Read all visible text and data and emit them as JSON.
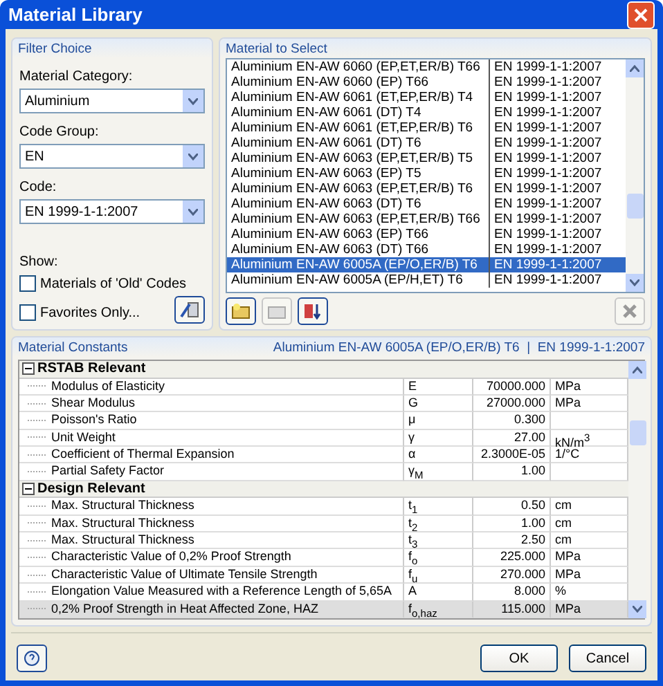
{
  "window": {
    "title": "Material Library"
  },
  "filter": {
    "title": "Filter Choice",
    "fields": [
      {
        "label": "Material Category:",
        "value": "Aluminium"
      },
      {
        "label": "Code Group:",
        "value": "EN"
      },
      {
        "label": "Code:",
        "value": "EN 1999-1-1:2007"
      }
    ],
    "show_label": "Show:",
    "checkboxes": [
      {
        "label": "Materials of 'Old' Codes",
        "checked": false
      },
      {
        "label": "Favorites Only...",
        "checked": false
      }
    ]
  },
  "materials": {
    "title": "Material to Select",
    "rows": [
      {
        "name": "Aluminium EN-AW 6060 (EP,ET,ER/B) T66",
        "code": "EN 1999-1-1:2007",
        "selected": false
      },
      {
        "name": "Aluminium EN-AW 6060 (EP) T66",
        "code": "EN 1999-1-1:2007",
        "selected": false
      },
      {
        "name": "Aluminium EN-AW 6061 (ET,EP,ER/B) T4",
        "code": "EN 1999-1-1:2007",
        "selected": false
      },
      {
        "name": "Aluminium EN-AW 6061 (DT) T4",
        "code": "EN 1999-1-1:2007",
        "selected": false
      },
      {
        "name": "Aluminium EN-AW 6061 (ET,EP,ER/B) T6",
        "code": "EN 1999-1-1:2007",
        "selected": false
      },
      {
        "name": "Aluminium EN-AW 6061 (DT) T6",
        "code": "EN 1999-1-1:2007",
        "selected": false
      },
      {
        "name": "Aluminium EN-AW 6063 (EP,ET,ER/B) T5",
        "code": "EN 1999-1-1:2007",
        "selected": false
      },
      {
        "name": "Aluminium EN-AW 6063 (EP) T5",
        "code": "EN 1999-1-1:2007",
        "selected": false
      },
      {
        "name": "Aluminium EN-AW 6063 (EP,ET,ER/B) T6",
        "code": "EN 1999-1-1:2007",
        "selected": false
      },
      {
        "name": "Aluminium EN-AW 6063 (DT) T6",
        "code": "EN 1999-1-1:2007",
        "selected": false
      },
      {
        "name": "Aluminium EN-AW 6063 (EP,ET,ER/B) T66",
        "code": "EN 1999-1-1:2007",
        "selected": false
      },
      {
        "name": "Aluminium EN-AW 6063 (EP) T66",
        "code": "EN 1999-1-1:2007",
        "selected": false
      },
      {
        "name": "Aluminium EN-AW 6063 (DT) T66",
        "code": "EN 1999-1-1:2007",
        "selected": false
      },
      {
        "name": "Aluminium EN-AW 6005A (EP/O,ER/B) T6",
        "code": "EN 1999-1-1:2007",
        "selected": true
      },
      {
        "name": "Aluminium EN-AW 6005A (EP/H,ET) T6",
        "code": "EN 1999-1-1:2007",
        "selected": false
      }
    ]
  },
  "constants": {
    "title": "Material Constants",
    "material": "Aluminium EN-AW 6005A (EP/O,ER/B) T6  |  EN 1999-1-1:2007",
    "groups": [
      {
        "name": "RSTAB Relevant",
        "expanded": true,
        "rows": [
          {
            "name": "Modulus of Elasticity",
            "symbol": "E",
            "value": "70000.000",
            "unit": "MPa",
            "selected": false
          },
          {
            "name": "Shear Modulus",
            "symbol": "G",
            "value": "27000.000",
            "unit": "MPa",
            "selected": false
          },
          {
            "name": "Poisson's Ratio",
            "symbol": "μ",
            "value": "0.300",
            "selected": false
          },
          {
            "name": "Unit Weight",
            "symbol": "γ",
            "value": "27.00",
            "unit": "kN/m$^{3}$",
            "selected": false
          },
          {
            "name": "Coefficient of Thermal Expansion",
            "symbol": "α",
            "value": "2.3000E-05",
            "unit": "1/°C",
            "selected": false
          },
          {
            "name": "Partial Safety Factor",
            "symbol": "γ$_{M}$",
            "value": "1.00",
            "selected": false
          }
        ]
      },
      {
        "name": "Design Relevant",
        "expanded": true,
        "rows": [
          {
            "name": "Max. Structural Thickness",
            "symbol": "t$_{1}$",
            "value": "0.50",
            "unit": "cm",
            "selected": false
          },
          {
            "name": "Max. Structural Thickness",
            "symbol": "t$_{2}$",
            "value": "1.00",
            "unit": "cm",
            "selected": false
          },
          {
            "name": "Max. Structural Thickness",
            "symbol": "t$_{3}$",
            "value": "2.50",
            "unit": "cm",
            "selected": false
          },
          {
            "name": "Characteristic Value of 0,2% Proof Strength",
            "symbol": "f$_{o}$",
            "value": "225.000",
            "unit": "MPa",
            "selected": false
          },
          {
            "name": "Characteristic Value of Ultimate Tensile Strength",
            "symbol": "f$_{u}$",
            "value": "270.000",
            "unit": "MPa",
            "selected": false
          },
          {
            "name": "Elongation Value Measured with a Reference Length of 5,65A",
            "symbol": "A",
            "value": "8.000",
            "unit": "%",
            "selected": false
          },
          {
            "name": "0,2% Proof Strength in Heat Affected Zone, HAZ",
            "symbol": "f$_{o,haz}$",
            "value": "115.000",
            "unit": "MPa",
            "selected": true
          }
        ]
      }
    ]
  },
  "buttons": [
    "OK",
    "Cancel"
  ]
}
